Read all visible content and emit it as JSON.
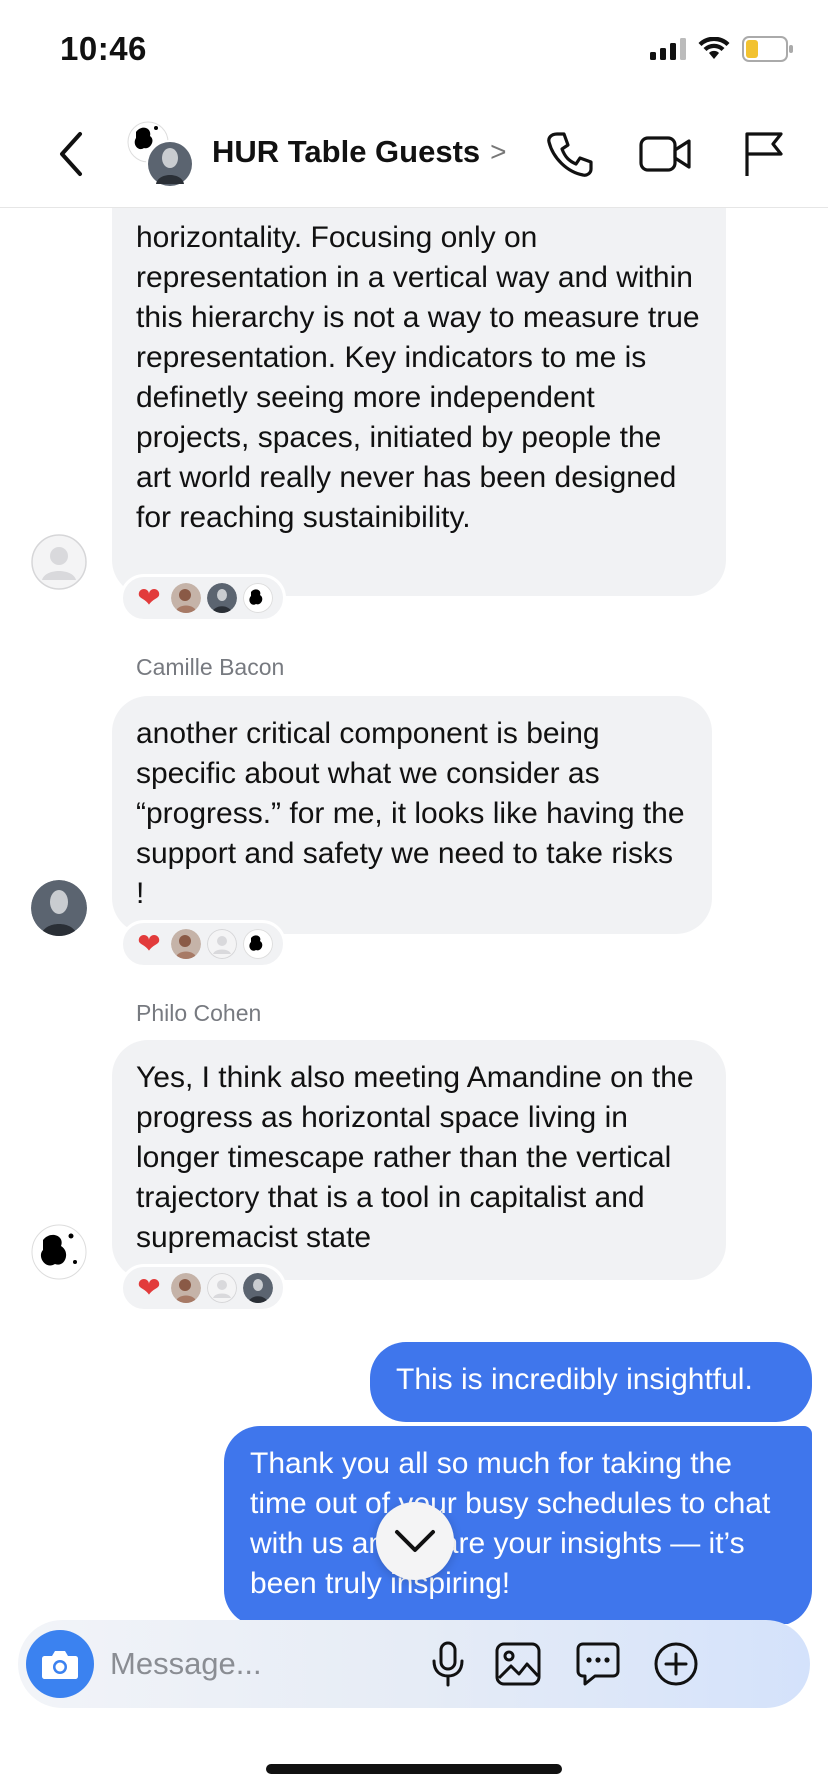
{
  "status": {
    "time": "10:46"
  },
  "header": {
    "title": "HUR Table Guests",
    "chevron": ">"
  },
  "messages": [
    {
      "id": "m1",
      "sender": "",
      "direction": "in",
      "text": "horizontality. Focusing only on representation in a vertical way and within this hierarchy is not a way to measure true representation. Key indicators to me is definetly seeing more independent projects, spaces, initiated by people the art world really never has been designed for reaching sustainibility.",
      "reactions": [
        "heart",
        "avatar-brown",
        "avatar-dark",
        "avatar-ink"
      ]
    },
    {
      "id": "m2",
      "sender": "Camille Bacon",
      "direction": "in",
      "text": "another critical component is being specific about what we consider as “progress.” for me, it looks like having the support and safety we need to take risks !",
      "reactions": [
        "heart",
        "avatar-brown",
        "avatar-blank",
        "avatar-ink"
      ]
    },
    {
      "id": "m3",
      "sender": "Philo Cohen",
      "direction": "in",
      "text": "Yes, I think also meeting Amandine on the progress as horizontal space living in longer timescape rather than the vertical trajectory that is a tool in capitalist and supremacist state",
      "reactions": [
        "heart",
        "avatar-brown",
        "avatar-blank",
        "avatar-dark"
      ]
    },
    {
      "id": "m4",
      "sender": "",
      "direction": "out",
      "text": "This is incredibly insightful."
    },
    {
      "id": "m5",
      "sender": "",
      "direction": "out",
      "text": "Thank you all so much for taking the time out of your busy schedules to chat with us and share your insights — it’s been truly inspiring!"
    }
  ],
  "composer": {
    "placeholder": "Message..."
  },
  "colors": {
    "outgoing": "#3f76ec",
    "incoming": "#f1f2f4",
    "camera": "#3b82f0",
    "heart": "#e23b3b"
  },
  "icons": {
    "header": [
      "back-chevron-icon",
      "phone-icon",
      "video-camera-icon",
      "flag-icon"
    ],
    "composer": [
      "camera-icon",
      "microphone-icon",
      "image-icon",
      "chat-bubble-icon",
      "plus-circle-icon"
    ]
  }
}
